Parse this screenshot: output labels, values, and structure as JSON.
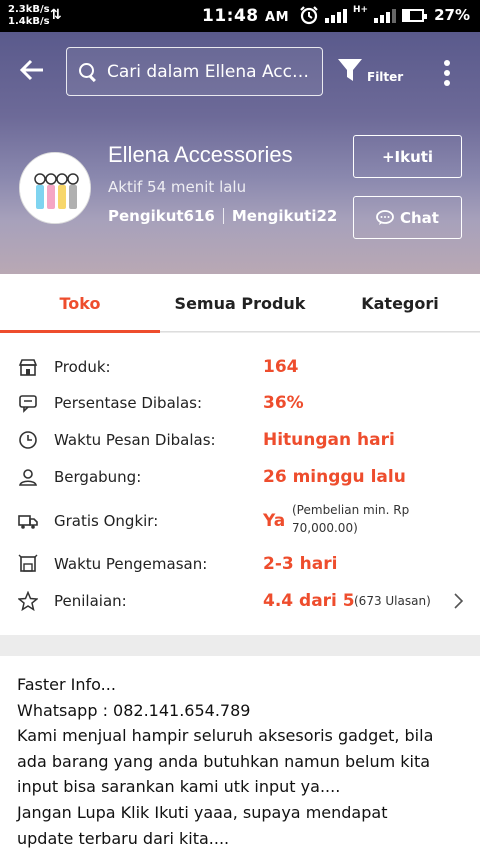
{
  "status_bar": {
    "net_up": "2.3kB/s",
    "net_down": "1.4kB/s",
    "time": "11:48",
    "ampm": "AM",
    "network": "H+",
    "battery": "27%"
  },
  "header": {
    "search_placeholder": "Cari dalam Ellena Accessories",
    "filter_label": "Filter",
    "shop_name": "Ellena Accessories",
    "active_status": "Aktif 54 menit lalu",
    "followers": "Pengikut616",
    "following": "Mengikuti22",
    "follow_label": "+Ikuti",
    "chat_label": "Chat"
  },
  "tabs": [
    {
      "label": "Toko",
      "active": true
    },
    {
      "label": "Semua Produk",
      "active": false
    },
    {
      "label": "Kategori",
      "active": false
    }
  ],
  "shop_info": [
    {
      "icon": "shop-icon",
      "label": "Produk:",
      "value": "164"
    },
    {
      "icon": "chat-bubble-icon",
      "label": "Persentase Dibalas:",
      "value": "36%"
    },
    {
      "icon": "clock-icon",
      "label": "Waktu Pesan Dibalas:",
      "value": "Hitungan hari"
    },
    {
      "icon": "person-icon",
      "label": "Bergabung:",
      "value": "26 minggu lalu"
    },
    {
      "icon": "truck-icon",
      "label": "Gratis Ongkir:",
      "value": "Ya",
      "note_line1": "(Pembelian min. Rp",
      "note_line2": "70,000.00)"
    },
    {
      "icon": "package-icon",
      "label": "Waktu Pengemasan:",
      "value": "2-3 hari"
    },
    {
      "icon": "star-icon",
      "label": "Penilaian:",
      "value": "4.4 dari 5",
      "note": "(673 Ulasan)"
    }
  ],
  "description": [
    "Faster Info...",
    "Whatsapp : 082.141.654.789",
    "Kami menjual hampir seluruh aksesoris gadget,  bila",
    "ada barang yang anda butuhkan namun belum kita",
    "input bisa sarankan kami utk input ya....",
    "Jangan Lupa Klik Ikuti yaaa, supaya mendapat",
    "update terbaru dari kita...."
  ],
  "colors": {
    "accent": "#ee4d2d",
    "header_top": "#5a5a8c",
    "header_bottom": "#b9a8b4"
  }
}
